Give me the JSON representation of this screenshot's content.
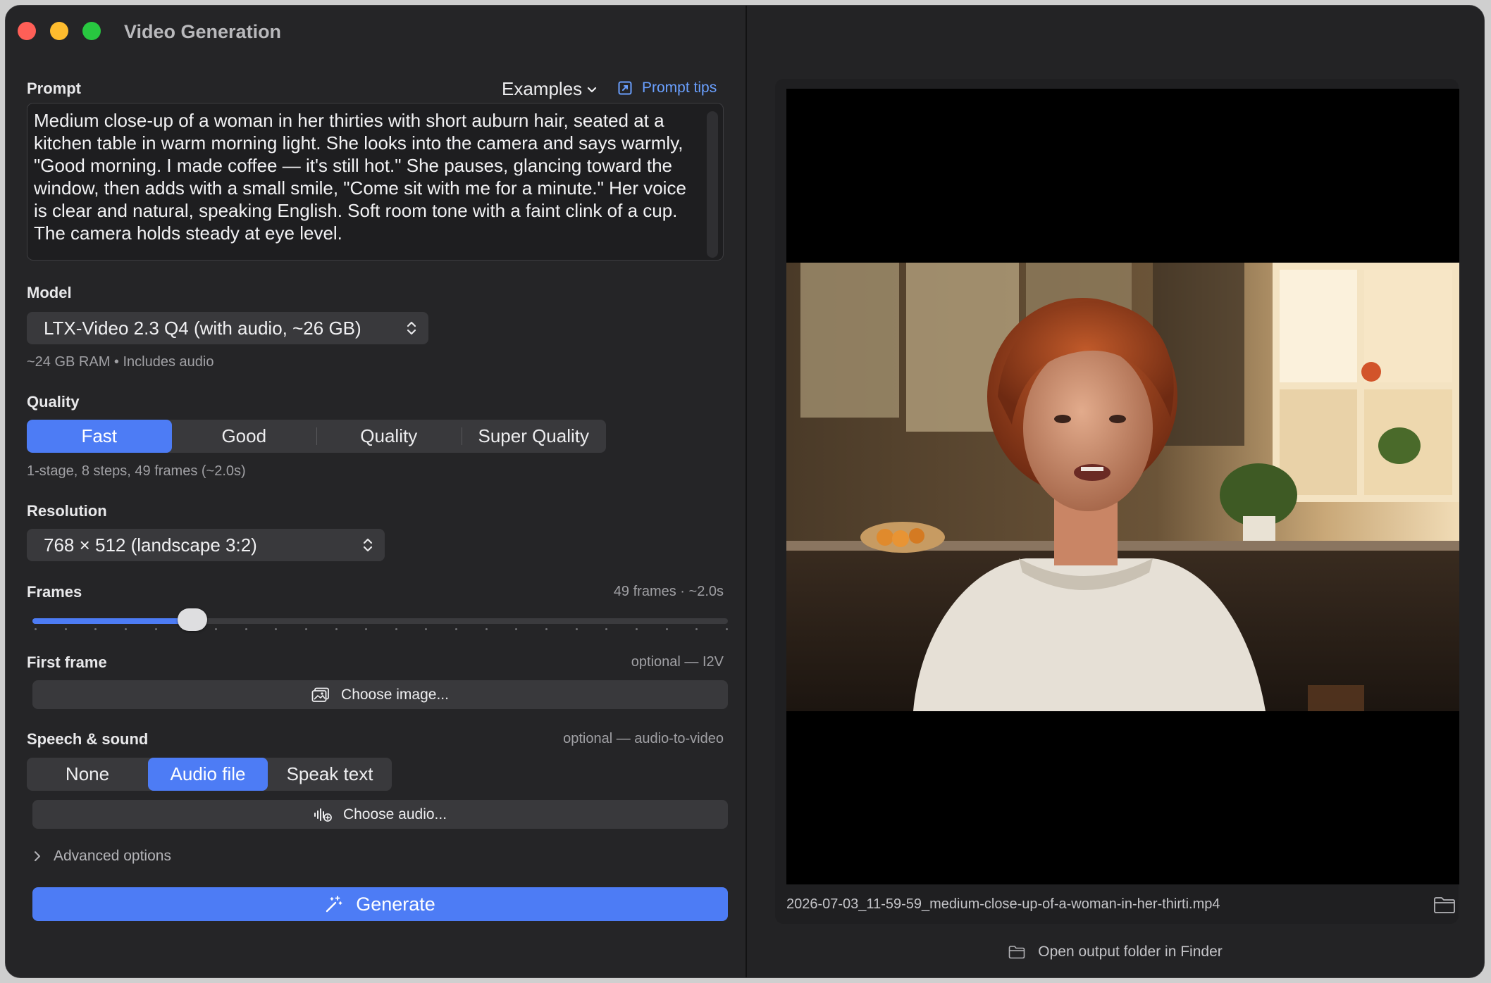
{
  "window": {
    "title": "Video Generation"
  },
  "prompt": {
    "label": "Prompt",
    "examples_label": "Examples",
    "tips_label": "Prompt tips",
    "text": "Medium close-up of a woman in her thirties with short auburn hair, seated at a kitchen table in warm morning light. She looks into the camera and says warmly, \"Good morning. I made coffee — it's still hot.\" She pauses, glancing toward the window, then adds with a small smile, \"Come sit with me for a minute.\" Her voice is clear and natural, speaking English. Soft room tone with a faint clink of a cup. The camera holds steady at eye level."
  },
  "model": {
    "label": "Model",
    "selected": "LTX-Video 2.3 Q4 (with audio, ~26 GB)",
    "hint": "~24 GB RAM • Includes audio"
  },
  "quality": {
    "label": "Quality",
    "options": [
      "Fast",
      "Good",
      "Quality",
      "Super Quality"
    ],
    "selected": "Fast",
    "hint": "1-stage, 8 steps, 49 frames (~2.0s)"
  },
  "resolution": {
    "label": "Resolution",
    "selected": "768 × 512 (landscape 3:2)"
  },
  "frames": {
    "label": "Frames",
    "value_text": "49 frames · ~2.0s",
    "slider_fraction": 0.23,
    "tick_count": 24
  },
  "first_frame": {
    "label": "First frame",
    "hint": "optional — I2V",
    "button_label": "Choose image..."
  },
  "speech": {
    "label": "Speech & sound",
    "hint": "optional — audio-to-video",
    "options": [
      "None",
      "Audio file",
      "Speak text"
    ],
    "selected": "Audio file",
    "button_label": "Choose audio..."
  },
  "advanced": {
    "label": "Advanced options"
  },
  "generate": {
    "label": "Generate"
  },
  "preview": {
    "filename": "2026-07-03_11-59-59_medium-close-up-of-a-woman-in-her-thirti.mp4",
    "open_folder_label": "Open output folder in Finder"
  },
  "colors": {
    "accent": "#4d7cf5",
    "link": "#6aa0ff",
    "window_bg": "#252527"
  },
  "icons": {
    "examples": "chevron-down-icon",
    "tips": "external-link-icon",
    "model": "updown-chevron-icon",
    "choose_image": "photo-icon",
    "choose_audio": "waveform-plus-icon",
    "advanced": "chevron-right-icon",
    "generate": "magic-wand-icon",
    "folder": "folder-icon"
  }
}
